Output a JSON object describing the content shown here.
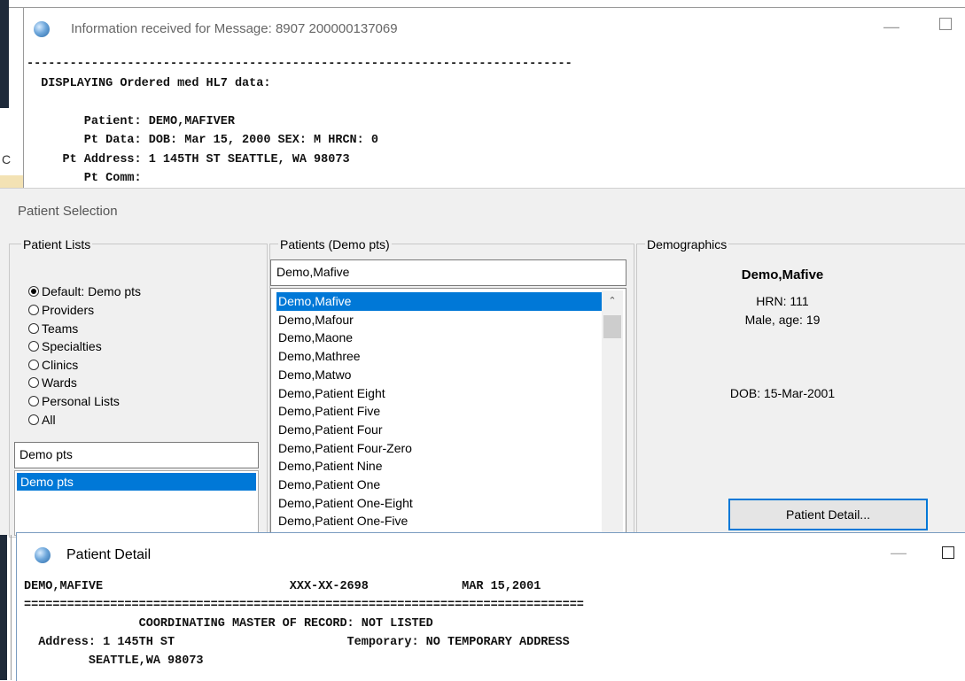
{
  "hl7_window": {
    "title": "Information received for Message: 8907 200000137069",
    "left_fragment": "C",
    "lines": [
      "----------------------------------------------------------------------------",
      "  DISPLAYING Ordered med HL7 data:",
      "",
      "        Patient: DEMO,MAFIVER",
      "        Pt Data: DOB: Mar 15, 2000 SEX: M HRCN: 0",
      "     Pt Address: 1 145TH ST SEATTLE, WA 98073",
      "        Pt Comm:"
    ]
  },
  "patient_selection": {
    "title": "Patient Selection",
    "patient_lists": {
      "label": "Patient Lists",
      "options": [
        {
          "label": "Default: Demo pts",
          "checked": true
        },
        {
          "label": "Providers",
          "checked": false
        },
        {
          "label": "Teams",
          "checked": false
        },
        {
          "label": "Specialties",
          "checked": false
        },
        {
          "label": "Clinics",
          "checked": false
        },
        {
          "label": "Wards",
          "checked": false
        },
        {
          "label": "Personal Lists",
          "checked": false
        },
        {
          "label": "All",
          "checked": false
        }
      ],
      "filter_value": "Demo pts",
      "list_items": [
        "Demo pts"
      ]
    },
    "patients": {
      "label": "Patients (Demo pts)",
      "search_value": "Demo,Mafive",
      "items": [
        "Demo,Mafive",
        "Demo,Mafour",
        "Demo,Maone",
        "Demo,Mathree",
        "Demo,Matwo",
        "Demo,Patient Eight",
        "Demo,Patient Five",
        "Demo,Patient Four",
        "Demo,Patient Four-Zero",
        "Demo,Patient Nine",
        "Demo,Patient One",
        "Demo,Patient One-Eight",
        "Demo,Patient One-Five"
      ],
      "selected_index": 0
    },
    "demographics": {
      "label": "Demographics",
      "name": "Demo,Mafive",
      "hrn": "HRN: 111",
      "sex_age": "Male, age: 19",
      "dob": "DOB: 15-Mar-2001",
      "detail_button": "Patient Detail..."
    }
  },
  "patient_detail": {
    "title": "Patient Detail",
    "lines": [
      "DEMO,MAFIVE                          XXX-XX-2698             MAR 15,2001",
      "==============================================================================",
      "                COORDINATING MASTER OF RECORD: NOT LISTED",
      "  Address: 1 145TH ST                        Temporary: NO TEMPORARY ADDRESS",
      "         SEATTLE,WA 98073"
    ]
  }
}
